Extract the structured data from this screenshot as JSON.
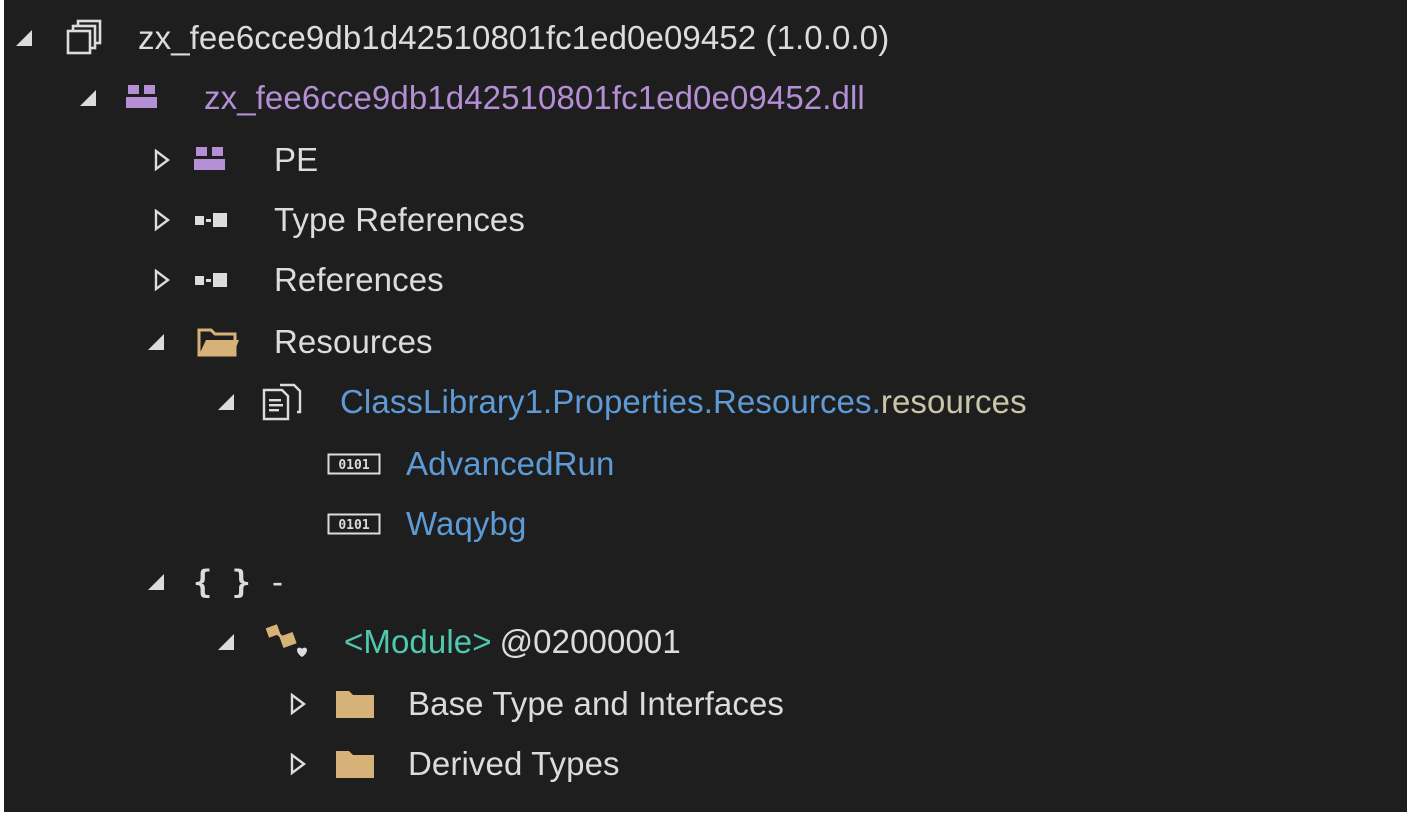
{
  "tree": {
    "assembly": {
      "label": "zx_fee6cce9db1d42510801fc1ed0e09452 (1.0.0.0)",
      "icon": "assembly-icon",
      "expanded": true
    },
    "module": {
      "label": "zx_fee6cce9db1d42510801fc1ed0e09452.dll",
      "icon": "module-icon",
      "expanded": true
    },
    "pe": {
      "label": "PE",
      "icon": "module-icon",
      "expanded": false
    },
    "type_references": {
      "label": "Type References",
      "icon": "reference-icon",
      "expanded": false
    },
    "references": {
      "label": "References",
      "icon": "reference-icon",
      "expanded": false
    },
    "resources": {
      "label": "Resources",
      "icon": "folder-open-icon",
      "expanded": true
    },
    "resource_file": {
      "label_main": "ClassLibrary1.Properties.Resources.",
      "label_ext": "resources",
      "icon": "resource-file-icon",
      "expanded": true
    },
    "advancedrun": {
      "label": "AdvancedRun",
      "icon": "binary-icon",
      "badge": "0101"
    },
    "waqybg": {
      "label": "Waqybg",
      "icon": "binary-icon",
      "badge": "0101"
    },
    "namespace": {
      "icon_text": "{ }",
      "label": "-",
      "expanded": true
    },
    "module_type": {
      "label": "<Module>",
      "token": "@02000001",
      "icon": "class-icon",
      "expanded": true
    },
    "base_types": {
      "label": "Base Type and Interfaces",
      "icon": "folder-icon",
      "expanded": false
    },
    "derived_types": {
      "label": "Derived Types",
      "icon": "folder-icon",
      "expanded": false
    }
  },
  "colors": {
    "background": "#1e1e1e",
    "text": "#dcdcdc",
    "module": "#b58fd6",
    "resource": "#5d9ad6",
    "type": "#4ec9b0",
    "folder": "#d6b278"
  }
}
